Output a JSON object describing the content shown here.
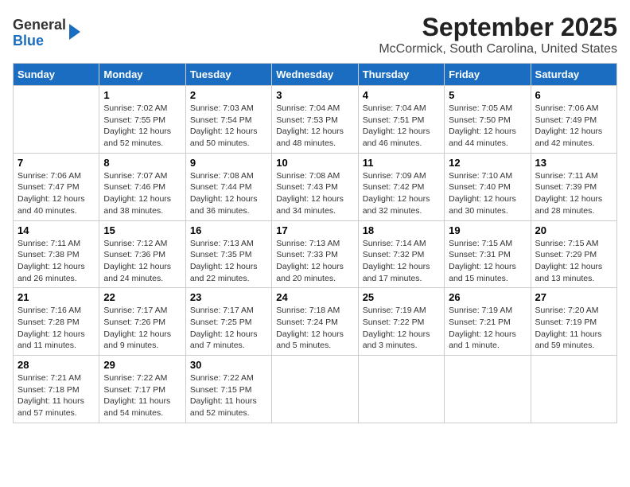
{
  "header": {
    "logo_line1": "General",
    "logo_line2": "Blue",
    "title": "September 2025",
    "subtitle": "McCormick, South Carolina, United States"
  },
  "days_of_week": [
    "Sunday",
    "Monday",
    "Tuesday",
    "Wednesday",
    "Thursday",
    "Friday",
    "Saturday"
  ],
  "weeks": [
    [
      {
        "day": "",
        "sunrise": "",
        "sunset": "",
        "daylight": ""
      },
      {
        "day": "1",
        "sunrise": "Sunrise: 7:02 AM",
        "sunset": "Sunset: 7:55 PM",
        "daylight": "Daylight: 12 hours and 52 minutes."
      },
      {
        "day": "2",
        "sunrise": "Sunrise: 7:03 AM",
        "sunset": "Sunset: 7:54 PM",
        "daylight": "Daylight: 12 hours and 50 minutes."
      },
      {
        "day": "3",
        "sunrise": "Sunrise: 7:04 AM",
        "sunset": "Sunset: 7:53 PM",
        "daylight": "Daylight: 12 hours and 48 minutes."
      },
      {
        "day": "4",
        "sunrise": "Sunrise: 7:04 AM",
        "sunset": "Sunset: 7:51 PM",
        "daylight": "Daylight: 12 hours and 46 minutes."
      },
      {
        "day": "5",
        "sunrise": "Sunrise: 7:05 AM",
        "sunset": "Sunset: 7:50 PM",
        "daylight": "Daylight: 12 hours and 44 minutes."
      },
      {
        "day": "6",
        "sunrise": "Sunrise: 7:06 AM",
        "sunset": "Sunset: 7:49 PM",
        "daylight": "Daylight: 12 hours and 42 minutes."
      }
    ],
    [
      {
        "day": "7",
        "sunrise": "Sunrise: 7:06 AM",
        "sunset": "Sunset: 7:47 PM",
        "daylight": "Daylight: 12 hours and 40 minutes."
      },
      {
        "day": "8",
        "sunrise": "Sunrise: 7:07 AM",
        "sunset": "Sunset: 7:46 PM",
        "daylight": "Daylight: 12 hours and 38 minutes."
      },
      {
        "day": "9",
        "sunrise": "Sunrise: 7:08 AM",
        "sunset": "Sunset: 7:44 PM",
        "daylight": "Daylight: 12 hours and 36 minutes."
      },
      {
        "day": "10",
        "sunrise": "Sunrise: 7:08 AM",
        "sunset": "Sunset: 7:43 PM",
        "daylight": "Daylight: 12 hours and 34 minutes."
      },
      {
        "day": "11",
        "sunrise": "Sunrise: 7:09 AM",
        "sunset": "Sunset: 7:42 PM",
        "daylight": "Daylight: 12 hours and 32 minutes."
      },
      {
        "day": "12",
        "sunrise": "Sunrise: 7:10 AM",
        "sunset": "Sunset: 7:40 PM",
        "daylight": "Daylight: 12 hours and 30 minutes."
      },
      {
        "day": "13",
        "sunrise": "Sunrise: 7:11 AM",
        "sunset": "Sunset: 7:39 PM",
        "daylight": "Daylight: 12 hours and 28 minutes."
      }
    ],
    [
      {
        "day": "14",
        "sunrise": "Sunrise: 7:11 AM",
        "sunset": "Sunset: 7:38 PM",
        "daylight": "Daylight: 12 hours and 26 minutes."
      },
      {
        "day": "15",
        "sunrise": "Sunrise: 7:12 AM",
        "sunset": "Sunset: 7:36 PM",
        "daylight": "Daylight: 12 hours and 24 minutes."
      },
      {
        "day": "16",
        "sunrise": "Sunrise: 7:13 AM",
        "sunset": "Sunset: 7:35 PM",
        "daylight": "Daylight: 12 hours and 22 minutes."
      },
      {
        "day": "17",
        "sunrise": "Sunrise: 7:13 AM",
        "sunset": "Sunset: 7:33 PM",
        "daylight": "Daylight: 12 hours and 20 minutes."
      },
      {
        "day": "18",
        "sunrise": "Sunrise: 7:14 AM",
        "sunset": "Sunset: 7:32 PM",
        "daylight": "Daylight: 12 hours and 17 minutes."
      },
      {
        "day": "19",
        "sunrise": "Sunrise: 7:15 AM",
        "sunset": "Sunset: 7:31 PM",
        "daylight": "Daylight: 12 hours and 15 minutes."
      },
      {
        "day": "20",
        "sunrise": "Sunrise: 7:15 AM",
        "sunset": "Sunset: 7:29 PM",
        "daylight": "Daylight: 12 hours and 13 minutes."
      }
    ],
    [
      {
        "day": "21",
        "sunrise": "Sunrise: 7:16 AM",
        "sunset": "Sunset: 7:28 PM",
        "daylight": "Daylight: 12 hours and 11 minutes."
      },
      {
        "day": "22",
        "sunrise": "Sunrise: 7:17 AM",
        "sunset": "Sunset: 7:26 PM",
        "daylight": "Daylight: 12 hours and 9 minutes."
      },
      {
        "day": "23",
        "sunrise": "Sunrise: 7:17 AM",
        "sunset": "Sunset: 7:25 PM",
        "daylight": "Daylight: 12 hours and 7 minutes."
      },
      {
        "day": "24",
        "sunrise": "Sunrise: 7:18 AM",
        "sunset": "Sunset: 7:24 PM",
        "daylight": "Daylight: 12 hours and 5 minutes."
      },
      {
        "day": "25",
        "sunrise": "Sunrise: 7:19 AM",
        "sunset": "Sunset: 7:22 PM",
        "daylight": "Daylight: 12 hours and 3 minutes."
      },
      {
        "day": "26",
        "sunrise": "Sunrise: 7:19 AM",
        "sunset": "Sunset: 7:21 PM",
        "daylight": "Daylight: 12 hours and 1 minute."
      },
      {
        "day": "27",
        "sunrise": "Sunrise: 7:20 AM",
        "sunset": "Sunset: 7:19 PM",
        "daylight": "Daylight: 11 hours and 59 minutes."
      }
    ],
    [
      {
        "day": "28",
        "sunrise": "Sunrise: 7:21 AM",
        "sunset": "Sunset: 7:18 PM",
        "daylight": "Daylight: 11 hours and 57 minutes."
      },
      {
        "day": "29",
        "sunrise": "Sunrise: 7:22 AM",
        "sunset": "Sunset: 7:17 PM",
        "daylight": "Daylight: 11 hours and 54 minutes."
      },
      {
        "day": "30",
        "sunrise": "Sunrise: 7:22 AM",
        "sunset": "Sunset: 7:15 PM",
        "daylight": "Daylight: 11 hours and 52 minutes."
      },
      {
        "day": "",
        "sunrise": "",
        "sunset": "",
        "daylight": ""
      },
      {
        "day": "",
        "sunrise": "",
        "sunset": "",
        "daylight": ""
      },
      {
        "day": "",
        "sunrise": "",
        "sunset": "",
        "daylight": ""
      },
      {
        "day": "",
        "sunrise": "",
        "sunset": "",
        "daylight": ""
      }
    ]
  ]
}
